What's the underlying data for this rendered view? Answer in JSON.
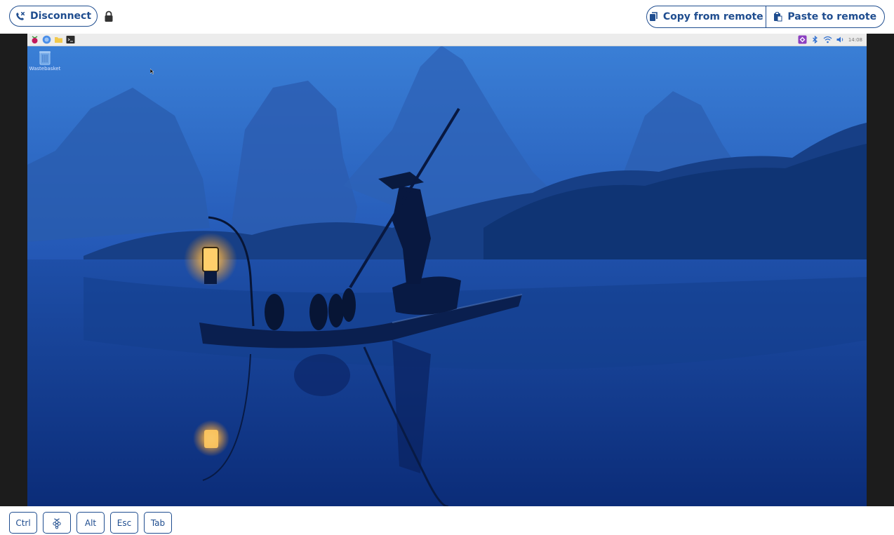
{
  "toolbar": {
    "disconnect_label": "Disconnect",
    "copy_label": "Copy from remote",
    "paste_label": "Paste to remote"
  },
  "remote_desktop": {
    "desktop_icon_label": "Wastebasket",
    "clock": "14:08"
  },
  "keys": {
    "ctrl": "Ctrl",
    "alt": "Alt",
    "esc": "Esc",
    "tab": "Tab"
  },
  "colors": {
    "accent": "#1f4d8f",
    "viewer_background": "#1c1c1c"
  },
  "icons": [
    "phone-disconnect-icon",
    "lock-icon",
    "clipboard-copy-icon",
    "clipboard-paste-icon",
    "raspberry-icon"
  ]
}
